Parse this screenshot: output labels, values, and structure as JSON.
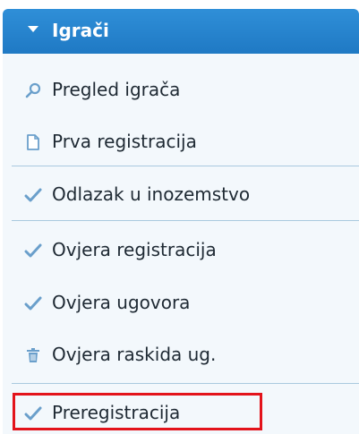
{
  "menu": {
    "title": "Igrači",
    "items": [
      {
        "label": "Pregled igrača",
        "icon": "search-icon"
      },
      {
        "label": "Prva registracija",
        "icon": "document-icon"
      },
      {
        "label": "Odlazak u inozemstvo",
        "icon": "checkmark-icon"
      },
      {
        "label": "Ovjera registracija",
        "icon": "checkmark-icon"
      },
      {
        "label": "Ovjera ugovora",
        "icon": "checkmark-icon"
      },
      {
        "label": "Ovjera raskida ug.",
        "icon": "trash-icon"
      },
      {
        "label": "Preregistracija",
        "icon": "checkmark-icon"
      }
    ]
  },
  "colors": {
    "header": "#2482cc",
    "icon": "#6a9fcb",
    "highlight": "#e3131b"
  }
}
